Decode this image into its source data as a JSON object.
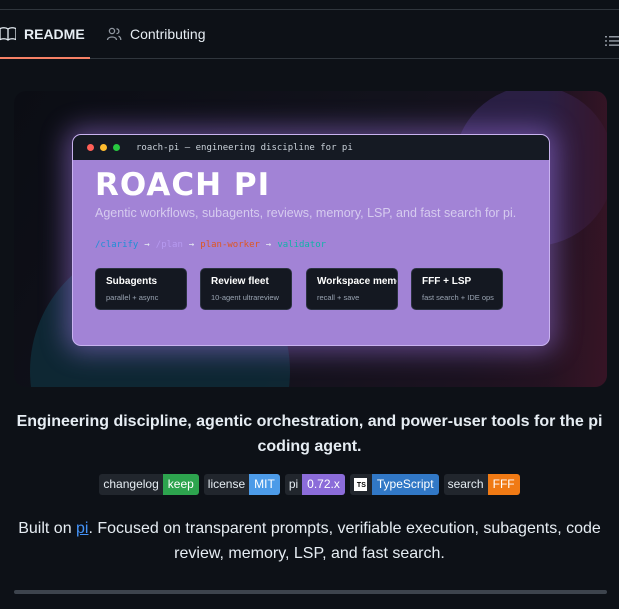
{
  "tabs": [
    {
      "label": "README",
      "icon": "book-icon",
      "active": true
    },
    {
      "label": "Contributing",
      "icon": "people-icon",
      "active": false
    }
  ],
  "banner": {
    "window_title": "roach-pi — engineering discipline for pi",
    "hero_title": "ROACH PI",
    "subtitle": "Agentic workflows, subagents, reviews, memory, LSP, and fast search for pi.",
    "flow": [
      {
        "text": "/clarify",
        "color": "#1f8fd6"
      },
      {
        "text": "→",
        "color": "#e6edf3"
      },
      {
        "text": "/plan",
        "color": "#b69af0"
      },
      {
        "text": "→",
        "color": "#e6edf3"
      },
      {
        "text": "plan-worker",
        "color": "#e0561f"
      },
      {
        "text": "→",
        "color": "#e6edf3"
      },
      {
        "text": "validator",
        "color": "#13b3a8"
      }
    ],
    "cards": [
      {
        "title": "Subagents",
        "subtitle": "parallel + async"
      },
      {
        "title": "Review fleet",
        "subtitle": "10-agent ultrareview"
      },
      {
        "title": "Workspace memory",
        "subtitle": "recall + save"
      },
      {
        "title": "FFF + LSP",
        "subtitle": "fast search + IDE ops"
      }
    ]
  },
  "tagline": "Engineering discipline, agentic orchestration, and power-user tools for the pi coding agent.",
  "badges": [
    {
      "label": "changelog",
      "value": "keep",
      "color": "#2da44e"
    },
    {
      "label": "license",
      "value": "MIT",
      "color": "#4c9be8"
    },
    {
      "label": "pi",
      "value": "0.72.x",
      "color": "#8b6cd9"
    },
    {
      "label": "TypeScript",
      "value": "",
      "color": "#3178c6",
      "icon": "typescript-icon"
    },
    {
      "label": "search",
      "value": "FFF",
      "color": "#f07a14"
    }
  ],
  "description": {
    "before": "Built on ",
    "link": "pi",
    "after": ". Focused on transparent prompts, verifiable execution, subagents, code review, memory, LSP, and fast search."
  }
}
